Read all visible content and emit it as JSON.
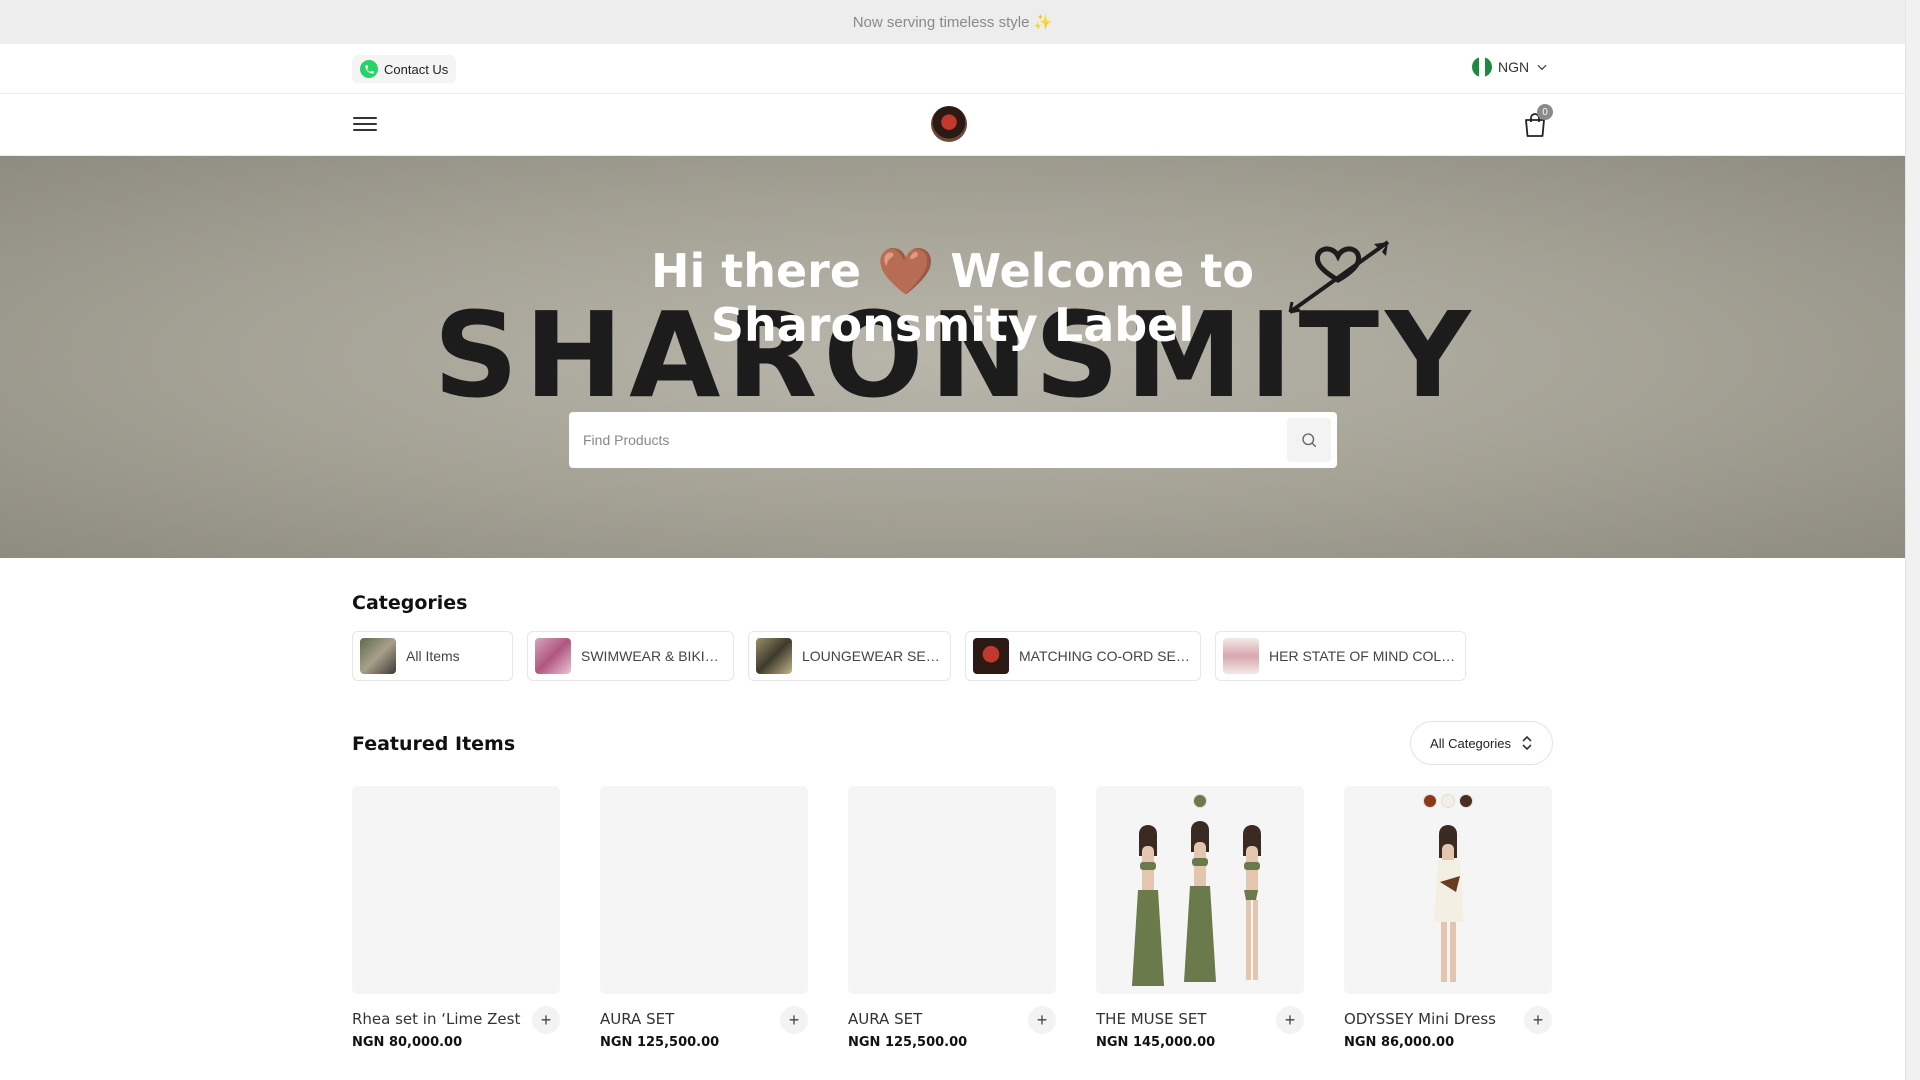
{
  "announcement": "Now serving timeless style ✨",
  "topbar": {
    "contact_label": "Contact Us",
    "currency": "NGN"
  },
  "navbar": {
    "cart_count": "0"
  },
  "hero": {
    "title_line1": "Hi there 🤎 Welcome to",
    "title_line2": "Sharonsmity Label",
    "brand_text": "SHARONSMITY",
    "search_placeholder": "Find Products"
  },
  "categories": {
    "title": "Categories",
    "items": [
      {
        "label": "All Items"
      },
      {
        "label": "SWIMWEAR & BIKINI SETS"
      },
      {
        "label": "LOUNGEWEAR SETS"
      },
      {
        "label": "MATCHING CO-ORD SETS"
      },
      {
        "label": "HER STATE OF MIND COLLECTION"
      }
    ]
  },
  "featured": {
    "title": "Featured Items",
    "filter_label": "All Categories",
    "products": [
      {
        "name": "Rhea set in ‘Lime Zest’",
        "price": "NGN 80,000.00",
        "swatches": []
      },
      {
        "name": "AURA SET",
        "price": "NGN 125,500.00",
        "swatches": []
      },
      {
        "name": "AURA SET",
        "price": "NGN 125,500.00",
        "swatches": []
      },
      {
        "name": "THE MUSE SET",
        "price": "NGN 145,000.00",
        "swatches": [
          "#6b7a4a"
        ]
      },
      {
        "name": "ODYSSEY Mini Dress",
        "price": "NGN 86,000.00",
        "swatches": [
          "#8b3a1a",
          "#f3efe2",
          "#4a2e22"
        ]
      }
    ]
  },
  "colors": {
    "whatsapp": "#25d366",
    "olive": "#6b7a4a",
    "hero_bg": "#a4a195"
  }
}
